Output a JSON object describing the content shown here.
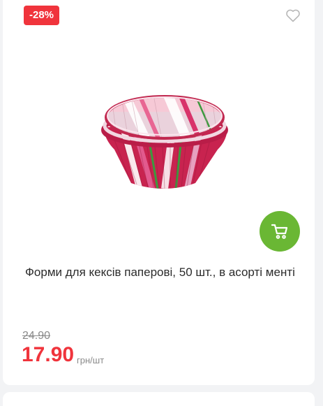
{
  "product": {
    "discount_badge": "-28%",
    "title": "Форми для кексів паперові, 50 шт., в асорті менті",
    "old_price": "24.90",
    "new_price": "17.90",
    "unit": "грн/шт"
  },
  "icons": {
    "favorite": "heart-outline-icon",
    "cart": "cart-icon"
  },
  "colors": {
    "badge": "#f0343c",
    "price": "#f0343c",
    "cart_button": "#6ab734"
  }
}
